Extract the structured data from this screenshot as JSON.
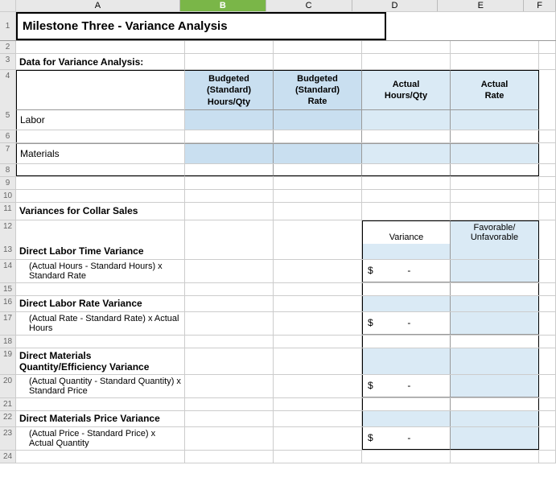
{
  "title": "Milestone Three - Variance Analysis",
  "sections": {
    "data_section_label": "Data for Variance Analysis:",
    "variance_section_label": "Variances for Collar Sales"
  },
  "col_headers": [
    "A",
    "B",
    "C",
    "D",
    "E",
    "F"
  ],
  "data_table_headers": {
    "col_b": [
      "Budgeted",
      "(Standard)",
      "Hours/Qty"
    ],
    "col_c": [
      "Budgeted",
      "(Standard)",
      "Rate"
    ],
    "col_d": [
      "Actual",
      "Hours/Qty"
    ],
    "col_e": [
      "Actual",
      "Rate"
    ]
  },
  "data_rows": {
    "labor_label": "Labor",
    "materials_label": "Materials"
  },
  "variance_table_headers": {
    "variance": "Variance",
    "favorable": "Favorable/",
    "unfavorable": "Unfavorable"
  },
  "variance_items": [
    {
      "title": "Direct Labor Time Variance",
      "formula": "(Actual Hours - Standard Hours) x Standard Rate",
      "dollar": "$",
      "value": "-"
    },
    {
      "title": "Direct Labor Rate Variance",
      "formula": "(Actual Rate - Standard Rate) x Actual Hours",
      "dollar": "$",
      "value": "-"
    },
    {
      "title": "Direct Materials Quantity/Efficiency Variance",
      "formula": "(Actual Quantity - Standard Quantity) x Standard Price",
      "dollar": "$",
      "value": "-"
    },
    {
      "title": "Direct Materials Price Variance",
      "formula": "(Actual Price - Standard Price) x Actual Quantity",
      "dollar": "$",
      "value": "-"
    }
  ]
}
